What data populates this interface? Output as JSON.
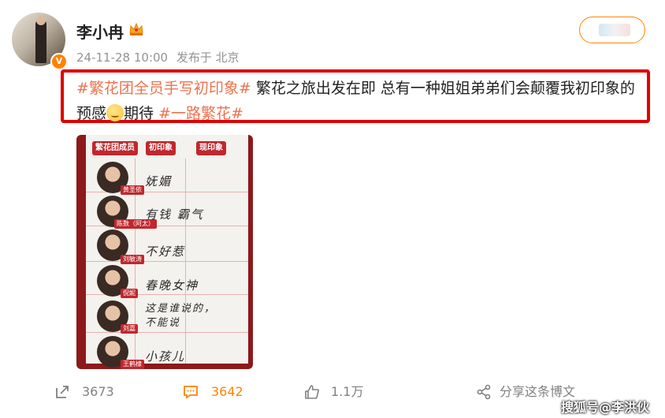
{
  "user": {
    "name": "李小冉",
    "timestamp": "24-11-28 10:00",
    "source": "发布于 北京",
    "verified_mark": "V"
  },
  "post": {
    "tag1": "#繁花团全员手写初印象#",
    "text": " 繁花之旅出发在即 总有一种姐姐弟弟们会颠覆我初印象的预感",
    "text2": "期待 ",
    "tag2": "#一路繁花#"
  },
  "image": {
    "headers": [
      "繁花团成员",
      "初印象",
      "现印象"
    ],
    "rows": [
      {
        "name": "黄圣依",
        "note": "妩媚"
      },
      {
        "name": "陈数（阿太）",
        "note": "有钱 霸气"
      },
      {
        "name": "刘敏涛",
        "note": "不好惹"
      },
      {
        "name": "倪妮",
        "note": "春晚女神"
      },
      {
        "name": "刘嘉",
        "note": "这是谁说的，不能说"
      },
      {
        "name": "王鹤棣",
        "note": "小孩儿"
      }
    ]
  },
  "actions": {
    "repost": "3673",
    "comment": "3642",
    "like": "1.1万",
    "share": "分享这条博文"
  },
  "watermark": "搜狐号@李洪伙",
  "colors": {
    "accent": "#ff8200",
    "tag": "#eb7350",
    "highlight_box": "#e00000",
    "comment_active": "#ff8200"
  }
}
